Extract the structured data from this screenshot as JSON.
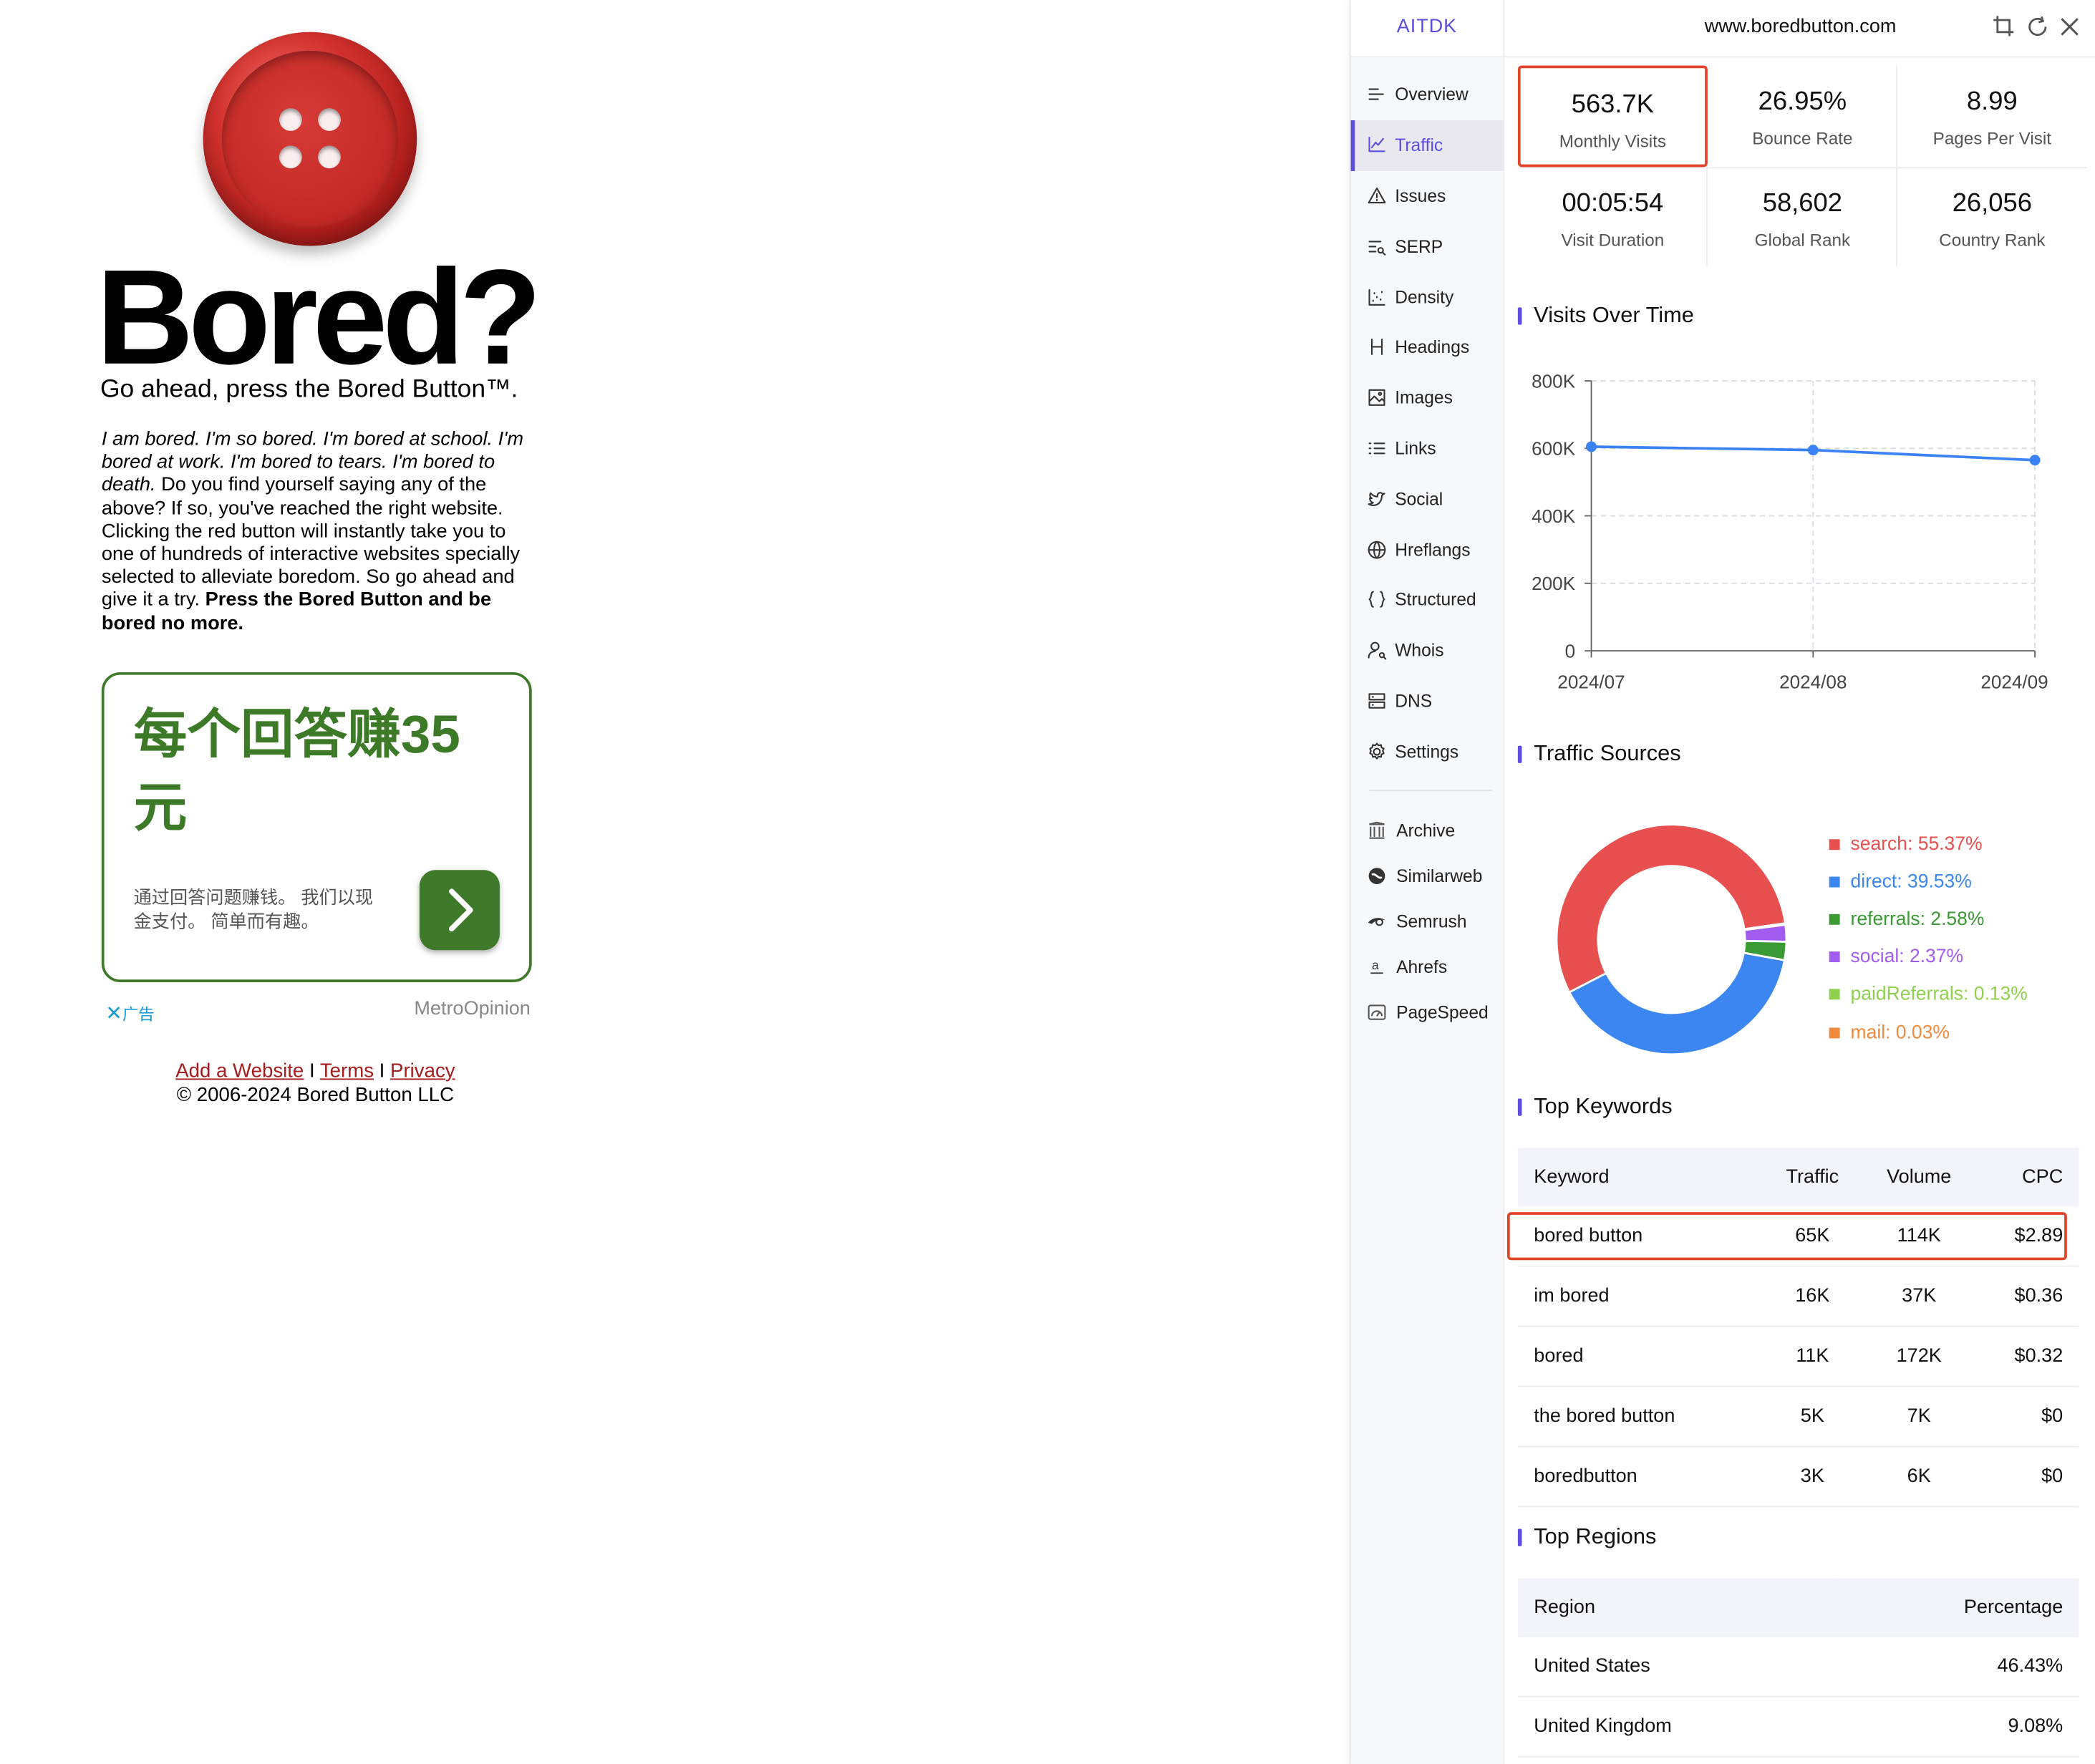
{
  "site": {
    "headline": "Bored?",
    "tagline": "Go ahead, press the Bored Button™.",
    "intro_italic": "I am bored. I'm so bored. I'm bored at school. I'm bored at work. I'm bored to tears. I'm bored to death.",
    "intro_plain": " Do you find yourself saying any of the above? If so, you've reached the right website. Clicking the red button will instantly take you to one of hundreds of interactive websites specially selected to alleviate boredom. So go ahead and give it a try. ",
    "intro_bold": "Press the Bored Button and be bored no more.",
    "ad": {
      "title": "每个回答赚35元",
      "body": "通过回答问题赚钱。 我们以现金支付。 简单而有趣。",
      "close_label": "广告",
      "sponsor": "MetroOpinion",
      "accent": "#3e7a2a"
    },
    "footer": {
      "link_add": "Add a Website",
      "sep1": " I ",
      "link_terms": "Terms",
      "sep2": " I ",
      "link_privacy": "Privacy",
      "copyright": "© 2006-2024 Bored Button LLC"
    }
  },
  "panel": {
    "brand": "AITDK",
    "domain": "www.boredbutton.com",
    "accent": "#5b4ee0",
    "nav": [
      {
        "label": "Overview",
        "icon": "overview-icon"
      },
      {
        "label": "Traffic",
        "icon": "traffic-icon",
        "active": true
      },
      {
        "label": "Issues",
        "icon": "warning-icon"
      },
      {
        "label": "SERP",
        "icon": "serp-icon"
      },
      {
        "label": "Density",
        "icon": "density-icon"
      },
      {
        "label": "Headings",
        "icon": "heading-icon"
      },
      {
        "label": "Images",
        "icon": "image-icon"
      },
      {
        "label": "Links",
        "icon": "list-icon"
      },
      {
        "label": "Social",
        "icon": "twitter-icon"
      },
      {
        "label": "Hreflangs",
        "icon": "globe-icon"
      },
      {
        "label": "Structured",
        "icon": "braces-icon"
      },
      {
        "label": "Whois",
        "icon": "user-search-icon"
      },
      {
        "label": "DNS",
        "icon": "server-icon"
      },
      {
        "label": "Settings",
        "icon": "gear-icon"
      }
    ],
    "external": [
      {
        "label": "Archive",
        "icon": "archive-icon"
      },
      {
        "label": "Similarweb",
        "icon": "similarweb-icon"
      },
      {
        "label": "Semrush",
        "icon": "semrush-icon"
      },
      {
        "label": "Ahrefs",
        "icon": "ahrefs-icon"
      },
      {
        "label": "PageSpeed",
        "icon": "pagespeed-icon"
      }
    ],
    "stats": [
      {
        "value": "563.7K",
        "label": "Monthly Visits",
        "highlighted": true
      },
      {
        "value": "26.95%",
        "label": "Bounce Rate"
      },
      {
        "value": "8.99",
        "label": "Pages Per Visit"
      },
      {
        "value": "00:05:54",
        "label": "Visit Duration"
      },
      {
        "value": "58,602",
        "label": "Global Rank"
      },
      {
        "value": "26,056",
        "label": "Country Rank"
      }
    ],
    "visits_title": "Visits Over Time",
    "sources_title": "Traffic Sources",
    "keywords_title": "Top Keywords",
    "regions_title": "Top Regions",
    "keywords": {
      "headers": [
        "Keyword",
        "Traffic",
        "Volume",
        "CPC"
      ],
      "rows": [
        [
          "bored button",
          "65K",
          "114K",
          "$2.89"
        ],
        [
          "im bored",
          "16K",
          "37K",
          "$0.36"
        ],
        [
          "bored",
          "11K",
          "172K",
          "$0.32"
        ],
        [
          "the bored button",
          "5K",
          "7K",
          "$0"
        ],
        [
          "boredbutton",
          "3K",
          "6K",
          "$0"
        ]
      ],
      "highlighted_row": 0
    },
    "regions": {
      "headers": [
        "Region",
        "Percentage"
      ],
      "rows": [
        [
          "United States",
          "46.43%"
        ],
        [
          "United Kingdom",
          "9.08%"
        ]
      ]
    },
    "highlight_color": "#e0452a"
  },
  "chart_data": [
    {
      "type": "line",
      "title": "Visits Over Time",
      "x": [
        "2024/07",
        "2024/08",
        "2024/09"
      ],
      "series": [
        {
          "values": [
            605000,
            595000,
            565000
          ]
        }
      ],
      "yticks": [
        "0",
        "200K",
        "400K",
        "600K",
        "800K"
      ],
      "ylim": [
        0,
        800000
      ],
      "grid": true,
      "color": "#3b82f6"
    },
    {
      "type": "pie",
      "title": "Traffic Sources",
      "legend_position": "right",
      "slices": [
        {
          "label": "search: 55.37%",
          "value": 55.37,
          "color": "#e85050"
        },
        {
          "label": "direct: 39.53%",
          "value": 39.53,
          "color": "#3b86f0"
        },
        {
          "label": "referrals: 2.58%",
          "value": 2.58,
          "color": "#3a9a33"
        },
        {
          "label": "social: 2.37%",
          "value": 2.37,
          "color": "#a25cf0"
        },
        {
          "label": "paidReferrals: 0.13%",
          "value": 0.13,
          "color": "#8fd14f"
        },
        {
          "label": "mail: 0.03%",
          "value": 0.03,
          "color": "#f08a3c"
        }
      ]
    }
  ]
}
